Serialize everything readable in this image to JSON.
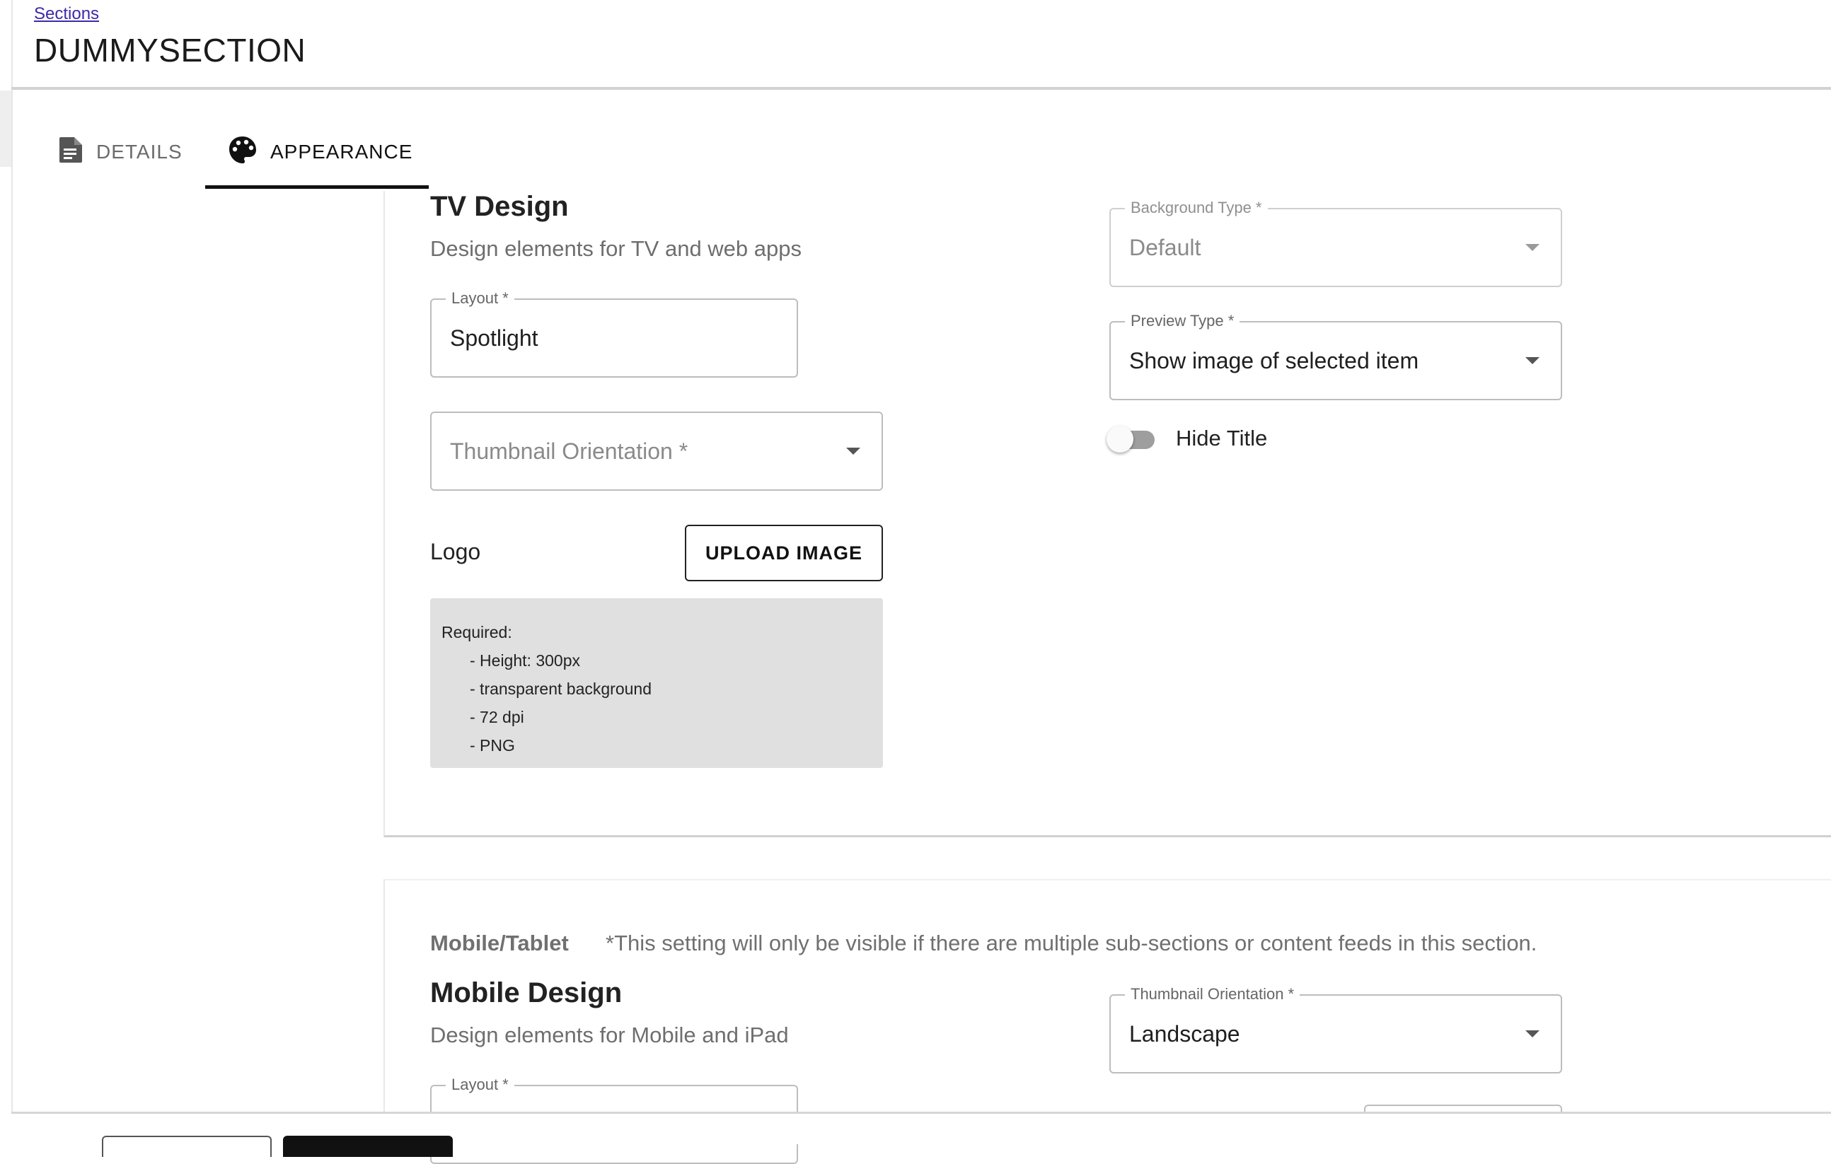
{
  "header": {
    "breadcrumb": "Sections",
    "title": "DUMMYSECTION"
  },
  "tabs": [
    {
      "label": "DETAILS",
      "icon": "document-icon",
      "active": false
    },
    {
      "label": "APPEARANCE",
      "icon": "palette-icon",
      "active": true
    }
  ],
  "tv_design": {
    "title": "TV Design",
    "subtitle": "Design elements for TV and web apps",
    "layout": {
      "label": "Layout *",
      "value": "Spotlight"
    },
    "thumbnail_orientation": {
      "placeholder": "Thumbnail Orientation *",
      "value": ""
    },
    "logo": {
      "label": "Logo",
      "upload_button": "UPLOAD IMAGE",
      "requirements_title": "Required:",
      "requirements": [
        "- Height: 300px",
        "- transparent background",
        "- 72 dpi",
        "- PNG"
      ]
    },
    "background_type": {
      "label": "Background Type *",
      "value": "Default",
      "disabled": true
    },
    "preview_type": {
      "label": "Preview Type *",
      "value": "Show image of selected item"
    },
    "hide_title": {
      "label": "Hide Title",
      "checked": false
    }
  },
  "mobile": {
    "tag": "Mobile/Tablet",
    "note": "*This setting will only be visible if there are multiple sub-sections or content feeds in this section.",
    "title": "Mobile Design",
    "subtitle": "Design elements for Mobile and iPad",
    "layout": {
      "label": "Layout *"
    },
    "thumbnail_orientation": {
      "label": "Thumbnail Orientation *",
      "value": "Landscape"
    }
  },
  "colors": {
    "link": "#3b2aa8",
    "active_tab": "#111111",
    "inactive_tab": "#6b6b6b",
    "requirements_bg": "#e0e0e0",
    "primary_button": "#111111"
  }
}
